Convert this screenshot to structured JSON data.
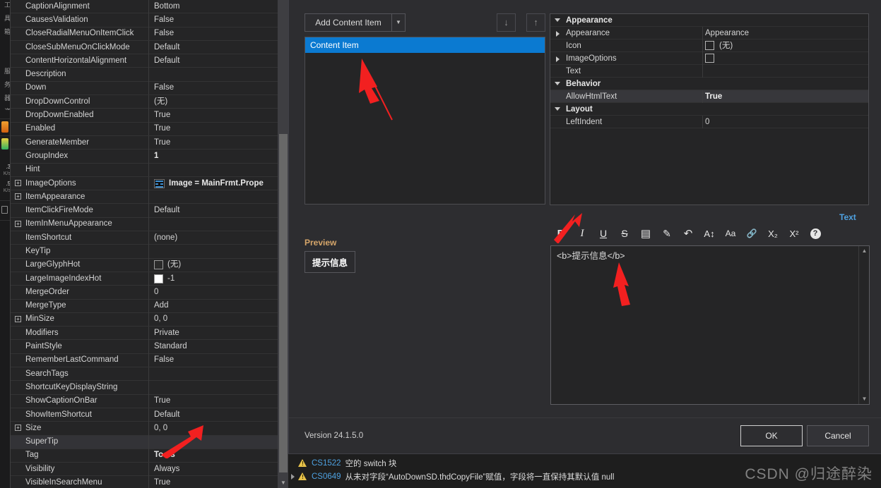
{
  "left_strip": {
    "vertical_texts": [
      "工 具 箱",
      "服 务 器 资 源 管 理 器"
    ],
    "numbers": [
      ".3",
      ".5"
    ],
    "units": [
      "K/s",
      "K/s"
    ]
  },
  "property_grid": {
    "rows": [
      {
        "name": "CaptionAlignment",
        "value": "Bottom",
        "expandable": false,
        "bold": false
      },
      {
        "name": "CausesValidation",
        "value": "False",
        "expandable": false,
        "bold": false
      },
      {
        "name": "CloseRadialMenuOnItemClick",
        "value": "False",
        "expandable": false,
        "bold": false
      },
      {
        "name": "CloseSubMenuOnClickMode",
        "value": "Default",
        "expandable": false,
        "bold": false
      },
      {
        "name": "ContentHorizontalAlignment",
        "value": "Default",
        "expandable": false,
        "bold": false
      },
      {
        "name": "Description",
        "value": "",
        "expandable": false,
        "bold": false
      },
      {
        "name": "Down",
        "value": "False",
        "expandable": false,
        "bold": false
      },
      {
        "name": "DropDownControl",
        "value": "(无)",
        "expandable": false,
        "bold": false
      },
      {
        "name": "DropDownEnabled",
        "value": "True",
        "expandable": false,
        "bold": false
      },
      {
        "name": "Enabled",
        "value": "True",
        "expandable": false,
        "bold": false
      },
      {
        "name": "GenerateMember",
        "value": "True",
        "expandable": false,
        "bold": false
      },
      {
        "name": "GroupIndex",
        "value": "1",
        "expandable": false,
        "bold": true
      },
      {
        "name": "Hint",
        "value": "",
        "expandable": false,
        "bold": false
      },
      {
        "name": "ImageOptions",
        "value": "Image = MainFrmt.Prope",
        "expandable": true,
        "bold": true,
        "icon": "image-glyph-icon"
      },
      {
        "name": "ItemAppearance",
        "value": "",
        "expandable": true,
        "bold": false
      },
      {
        "name": "ItemClickFireMode",
        "value": "Default",
        "expandable": false,
        "bold": false
      },
      {
        "name": "ItemInMenuAppearance",
        "value": "",
        "expandable": true,
        "bold": false
      },
      {
        "name": "ItemShortcut",
        "value": "(none)",
        "expandable": false,
        "bold": false
      },
      {
        "name": "KeyTip",
        "value": "",
        "expandable": false,
        "bold": false
      },
      {
        "name": "LargeGlyphHot",
        "value": "(无)",
        "expandable": false,
        "bold": false,
        "swatch": "#2b2b2b"
      },
      {
        "name": "LargeImageIndexHot",
        "value": "-1",
        "expandable": false,
        "bold": false,
        "swatch": "#ffffff"
      },
      {
        "name": "MergeOrder",
        "value": "0",
        "expandable": false,
        "bold": false
      },
      {
        "name": "MergeType",
        "value": "Add",
        "expandable": false,
        "bold": false
      },
      {
        "name": "MinSize",
        "value": "0, 0",
        "expandable": true,
        "bold": false
      },
      {
        "name": "Modifiers",
        "value": "Private",
        "expandable": false,
        "bold": false
      },
      {
        "name": "PaintStyle",
        "value": "Standard",
        "expandable": false,
        "bold": false
      },
      {
        "name": "RememberLastCommand",
        "value": "False",
        "expandable": false,
        "bold": false
      },
      {
        "name": "SearchTags",
        "value": "",
        "expandable": false,
        "bold": false
      },
      {
        "name": "ShortcutKeyDisplayString",
        "value": "",
        "expandable": false,
        "bold": false
      },
      {
        "name": "ShowCaptionOnBar",
        "value": "True",
        "expandable": false,
        "bold": false
      },
      {
        "name": "ShowItemShortcut",
        "value": "Default",
        "expandable": false,
        "bold": false
      },
      {
        "name": "Size",
        "value": "0, 0",
        "expandable": true,
        "bold": false
      },
      {
        "name": "SuperTip",
        "value": "",
        "expandable": false,
        "bold": false,
        "selected": true
      },
      {
        "name": "Tag",
        "value": "Tools",
        "expandable": false,
        "bold": true
      },
      {
        "name": "Visibility",
        "value": "Always",
        "expandable": false,
        "bold": false
      },
      {
        "name": "VisibleInSearchMenu",
        "value": "True",
        "expandable": false,
        "bold": false
      }
    ]
  },
  "dialog": {
    "toolbar": {
      "add_content_item_label": "Add Content Item",
      "dropdown_glyph": "▼",
      "move_down_glyph": "↓",
      "move_up_glyph": "↑"
    },
    "item_list": {
      "items": [
        {
          "label": "Content Item",
          "selected": true
        }
      ]
    },
    "preview": {
      "label": "Preview",
      "button_text": "提示信息"
    },
    "properties": {
      "groups": [
        {
          "title": "Appearance",
          "rows": [
            {
              "name": "Appearance",
              "value": "Appearance",
              "expandable": true,
              "bold": false
            },
            {
              "name": "Icon",
              "value": "(无)",
              "expandable": false,
              "bold": false,
              "swatch": true
            },
            {
              "name": "ImageOptions",
              "value": "",
              "expandable": true,
              "bold": false,
              "swatch": true
            },
            {
              "name": "Text",
              "value": "",
              "expandable": false,
              "bold": false
            }
          ]
        },
        {
          "title": "Behavior",
          "rows": [
            {
              "name": "AllowHtmlText",
              "value": "True",
              "expandable": false,
              "bold": true,
              "selected": true
            }
          ]
        },
        {
          "title": "Layout",
          "rows": [
            {
              "name": "LeftIndent",
              "value": "0",
              "expandable": false,
              "bold": false
            }
          ]
        }
      ]
    },
    "text_editor": {
      "label": "Text",
      "content": "<b>提示信息</b>",
      "toolbar_buttons": [
        {
          "name": "bold-icon",
          "glyph": "B"
        },
        {
          "name": "italic-icon",
          "glyph": "I"
        },
        {
          "name": "underline-icon",
          "glyph": "U"
        },
        {
          "name": "strikethrough-icon",
          "glyph": "S"
        },
        {
          "name": "paragraph-align-icon",
          "glyph": "▤"
        },
        {
          "name": "edit-pencil-icon",
          "glyph": "✎"
        },
        {
          "name": "undo-format-icon",
          "glyph": "↶"
        },
        {
          "name": "font-size-icon",
          "glyph": "A↕"
        },
        {
          "name": "font-case-icon",
          "glyph": "Aa"
        },
        {
          "name": "hyperlink-icon",
          "glyph": "🔗"
        },
        {
          "name": "subscript-icon",
          "glyph": "X₂"
        },
        {
          "name": "superscript-icon",
          "glyph": "X²"
        },
        {
          "name": "help-icon",
          "glyph": "?"
        }
      ]
    },
    "footer": {
      "version": "Version 24.1.5.0",
      "ok_label": "OK",
      "cancel_label": "Cancel"
    }
  },
  "error_list": {
    "rows": [
      {
        "code": "CS1522",
        "message": "空的 switch 块",
        "severity": "warning",
        "expandable": false
      },
      {
        "code": "CS0649",
        "message": "从未对字段“AutoDownSD.thdCopyFile”赋值，字段将一直保持其默认值 null",
        "severity": "warning",
        "expandable": true
      }
    ]
  },
  "watermark": "CSDN @归途醉染",
  "colors": {
    "selection_blue": "#0b7ad1",
    "link_blue": "#4ea1e0",
    "accent_orange": "#d6a66a",
    "warning_yellow": "#e8c34a",
    "annotation_red": "#f22020"
  }
}
